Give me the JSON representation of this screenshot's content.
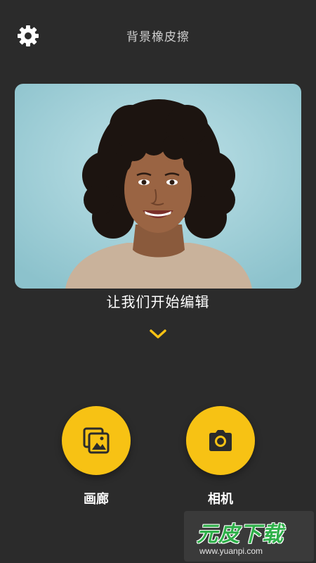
{
  "header": {
    "title": "背景橡皮擦",
    "settings_icon": "gear-icon"
  },
  "hero": {
    "caption": "让我们开始编辑",
    "expand_icon": "chevron-down-icon"
  },
  "actions": [
    {
      "label": "画廊",
      "icon": "gallery-icon"
    },
    {
      "label": "相机",
      "icon": "camera-icon"
    }
  ],
  "watermark": {
    "brand": "元皮下载",
    "url": "www.yuanpi.com"
  },
  "colors": {
    "background": "#2b2b2b",
    "accent": "#f7c214",
    "hero_backdrop": "#a8d4dc"
  }
}
